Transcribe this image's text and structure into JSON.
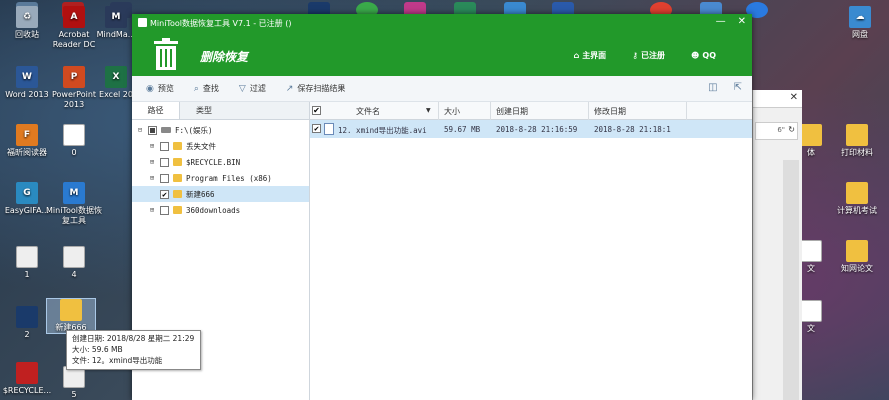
{
  "desktop": {
    "left_icons": [
      {
        "label": "回收站"
      },
      {
        "label": "Word 2013"
      },
      {
        "label": "福昕阅读器"
      },
      {
        "label": "EasyGIFA..."
      },
      {
        "label": "1"
      },
      {
        "label": "2"
      },
      {
        "label": "$RECYCLE..."
      }
    ],
    "second_col_icons": [
      {
        "label": "Acrobat Reader DC"
      },
      {
        "label": "PowerPoint 2013"
      },
      {
        "label": "0"
      },
      {
        "label": "MiniTool数据恢复工具"
      },
      {
        "label": "4"
      },
      {
        "label": "新建666"
      },
      {
        "label": "5"
      }
    ],
    "third_col_icons": [
      {
        "label": "MindMa..."
      },
      {
        "label": "Excel 20"
      }
    ],
    "right_icons": [
      {
        "label": "网盘"
      },
      {
        "label": "体"
      },
      {
        "label": "打印材料"
      },
      {
        "label": "计算机考试"
      },
      {
        "label": "文"
      },
      {
        "label": "知网论文"
      },
      {
        "label": "文"
      }
    ],
    "tooltip": {
      "created": "创建日期: 2018/8/28 星期二 21:29",
      "size": "大小: 59.6 MB",
      "files": "文件: 12。xmind导出功能"
    },
    "bg_window_text": "6\""
  },
  "app": {
    "title": "MiniTool数据恢复工具 V7.1 - 已注册 ()",
    "section_title": "删除恢复",
    "nav": {
      "home": "主界面",
      "registered": "已注册",
      "qq": "QQ"
    },
    "toolbar": {
      "preview": "预览",
      "find": "查找",
      "filter": "过滤",
      "save_scan": "保存扫描结果"
    },
    "tabs": {
      "path": "路径",
      "type": "类型"
    },
    "tree": [
      {
        "label": "F:\\(娱乐)",
        "level": 0,
        "expander": "−",
        "check": "partial",
        "icon": "drive"
      },
      {
        "label": "丢失文件",
        "level": 1,
        "expander": "+",
        "check": "none",
        "icon": "folder"
      },
      {
        "label": "$RECYCLE.BIN",
        "level": 1,
        "expander": "+",
        "check": "none",
        "icon": "folder"
      },
      {
        "label": "Program Files (x86)",
        "level": 1,
        "expander": "+",
        "check": "none",
        "icon": "folder"
      },
      {
        "label": "新建666",
        "level": 1,
        "expander": "",
        "check": "checked",
        "icon": "folder",
        "selected": true
      },
      {
        "label": "360downloads",
        "level": 1,
        "expander": "+",
        "check": "none",
        "icon": "folder"
      }
    ],
    "grid": {
      "columns": {
        "name": "文件名",
        "size": "大小",
        "created": "创建日期",
        "modified": "修改日期"
      },
      "rows": [
        {
          "name": "12. xmind导出功能.avi",
          "size": "59.67 MB",
          "created": "2018-8-28 21:16:59",
          "modified": "2018-8-28 21:18:1"
        }
      ]
    },
    "colors": {
      "titlebar": "#22992a",
      "selection": "#cfe6f7"
    }
  }
}
